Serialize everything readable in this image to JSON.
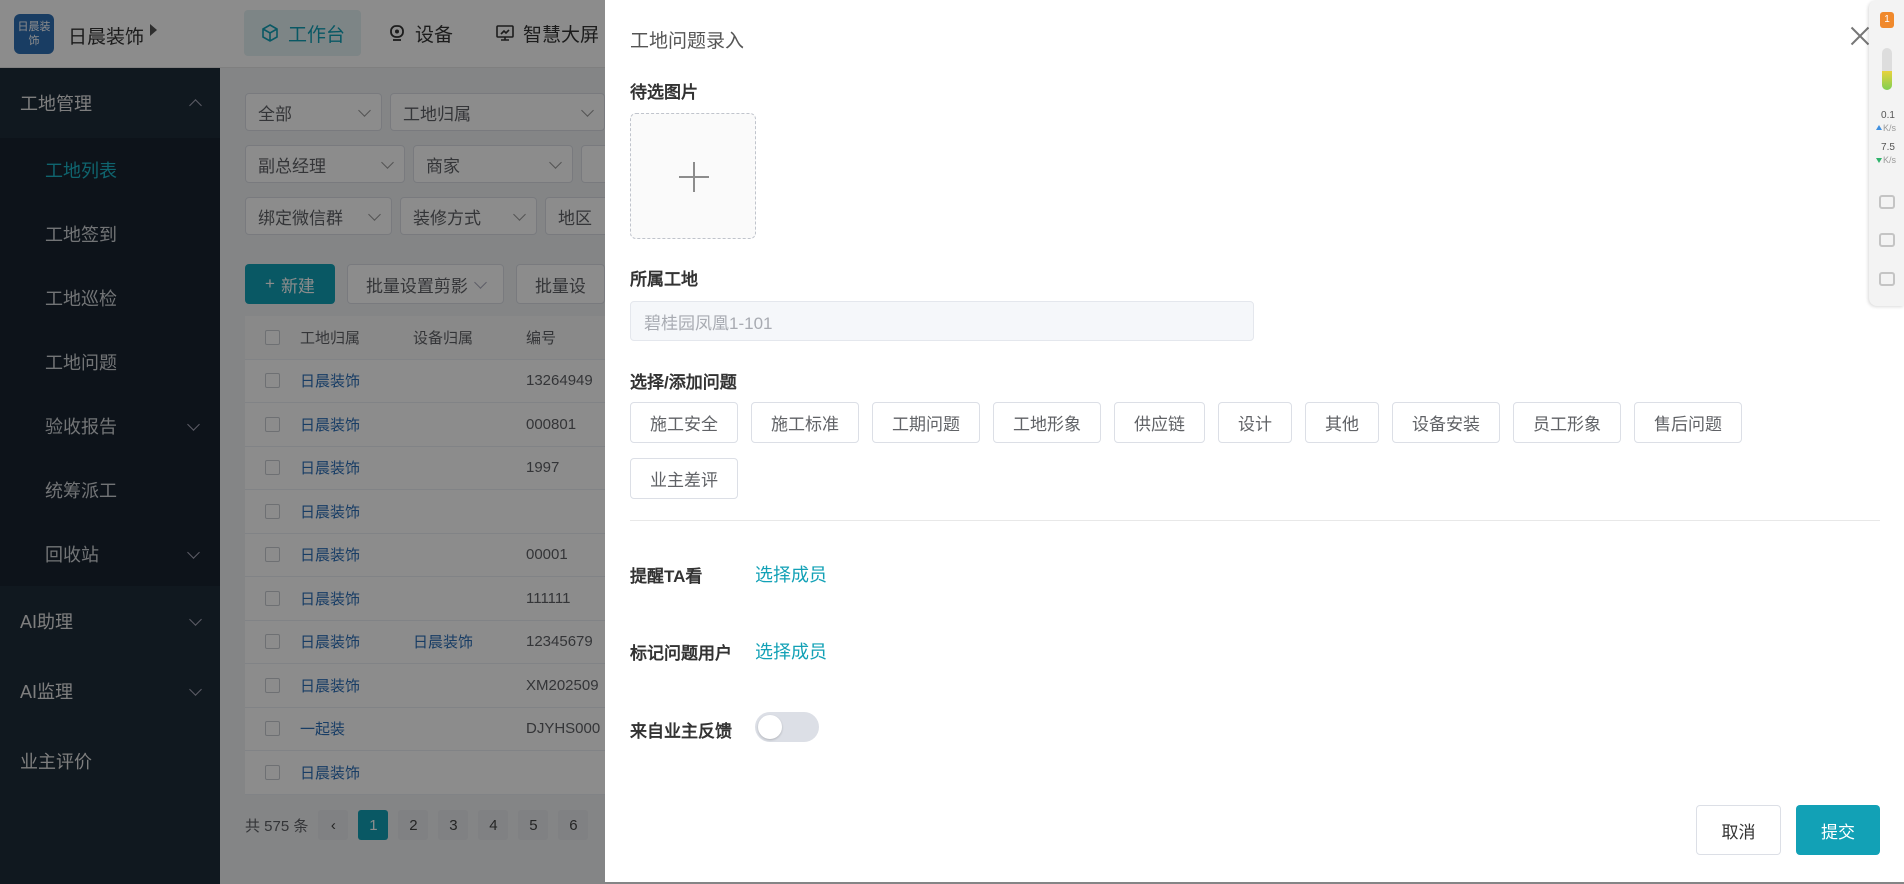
{
  "app": {
    "logo_text": "日晨装饰",
    "brand": "日晨装饰",
    "top_nav": [
      {
        "label": "工作台",
        "icon": "cube-icon"
      },
      {
        "label": "设备",
        "icon": "camera-icon"
      },
      {
        "label": "智慧大屏",
        "icon": "monitor-icon"
      }
    ]
  },
  "sidebar": {
    "group_site": "工地管理",
    "items": [
      "工地列表",
      "工地签到",
      "工地巡检",
      "工地问题",
      "验收报告",
      "统筹派工",
      "回收站"
    ],
    "group_ai_assistant": "AI助理",
    "group_ai_supervision": "AI监理",
    "group_owner_review": "业主评价"
  },
  "filters": {
    "row1": [
      "全部",
      "工地归属"
    ],
    "row2": [
      "副总经理",
      "商家",
      ""
    ],
    "row3": [
      "绑定微信群",
      "装修方式",
      "地区"
    ]
  },
  "actions": {
    "new_label": "新建",
    "batch_clip": "批量设置剪影",
    "batch_more": "批量设"
  },
  "table": {
    "headers": [
      "工地归属",
      "设备归属",
      "编号"
    ],
    "rows": [
      [
        "日晨装饰",
        "",
        "13264949"
      ],
      [
        "日晨装饰",
        "",
        "000801"
      ],
      [
        "日晨装饰",
        "",
        "1997"
      ],
      [
        "日晨装饰",
        "",
        ""
      ],
      [
        "日晨装饰",
        "",
        "00001"
      ],
      [
        "日晨装饰",
        "",
        "111111"
      ],
      [
        "日晨装饰",
        "日晨装饰",
        "12345679"
      ],
      [
        "日晨装饰",
        "",
        "XM202509"
      ],
      [
        "一起装",
        "",
        "DJYHS000"
      ],
      [
        "日晨装饰",
        "",
        ""
      ]
    ]
  },
  "pagination": {
    "total": "共 575 条",
    "pages": [
      "1",
      "2",
      "3",
      "4",
      "5",
      "6"
    ],
    "current": "1"
  },
  "drawer": {
    "title": "工地问题录入",
    "images_label": "待选图片",
    "site_label": "所属工地",
    "site_value": "碧桂园凤凰1-101",
    "issue_label": "选择/添加问题",
    "issue_tags": [
      "施工安全",
      "施工标准",
      "工期问题",
      "工地形象",
      "供应链",
      "设计",
      "其他",
      "设备安装",
      "员工形象",
      "售后问题",
      "业主差评"
    ],
    "remind_label": "提醒TA看",
    "remind_link": "选择成员",
    "mark_label": "标记问题用户",
    "mark_link": "选择成员",
    "owner_feedback_label": "来自业主反馈",
    "owner_feedback_on": false,
    "cancel_label": "取消",
    "submit_label": "提交"
  },
  "widget": {
    "badge": "1",
    "level": 0.45,
    "up_speed": "0.1",
    "down_speed": "7.5",
    "unit": "K/s"
  },
  "colors": {
    "accent": "#12a1b6",
    "sidebar_bg": "#1e2c3a",
    "link_blue": "#2d6fb8"
  }
}
